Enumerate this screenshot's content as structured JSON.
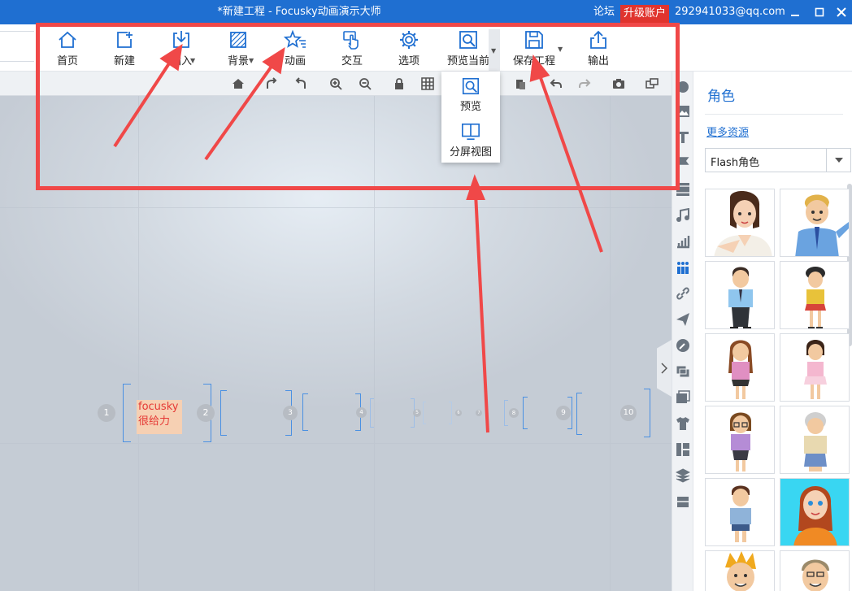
{
  "window": {
    "title": "*新建工程 - Focusky动画演示大师",
    "forum": "论坛",
    "upgrade": "升级账户",
    "account": "292941033@qq.com",
    "accent": "#1f6fd1"
  },
  "toolbar": {
    "items": [
      {
        "label": "首页",
        "icon": "home-icon"
      },
      {
        "label": "新建",
        "icon": "new-icon"
      },
      {
        "label": "插入",
        "icon": "insert-icon"
      },
      {
        "label": "背景",
        "icon": "background-icon"
      },
      {
        "label": "动画",
        "icon": "animation-icon"
      },
      {
        "label": "交互",
        "icon": "interaction-icon"
      },
      {
        "label": "选项",
        "icon": "gear-icon"
      },
      {
        "label": "预览当前",
        "icon": "preview-icon"
      },
      {
        "label": "保存工程",
        "icon": "save-icon"
      },
      {
        "label": "输出",
        "icon": "export-icon"
      }
    ]
  },
  "preview_menu": {
    "items": [
      {
        "label": "预览",
        "icon": "preview-icon"
      },
      {
        "label": "分屏视图",
        "icon": "split-screen-icon"
      }
    ]
  },
  "canvas": {
    "frame1_text": [
      "focusky",
      "很给力"
    ],
    "frame1_text_color": "#e53935",
    "badges": [
      "1",
      "2",
      "3",
      "4",
      "5",
      "6",
      "7",
      "8",
      "9",
      "10"
    ]
  },
  "right_panel": {
    "title": "角色",
    "more_resources": "更多资源",
    "category_selected": "Flash角色"
  },
  "annotation": {
    "color": "#f04848"
  }
}
